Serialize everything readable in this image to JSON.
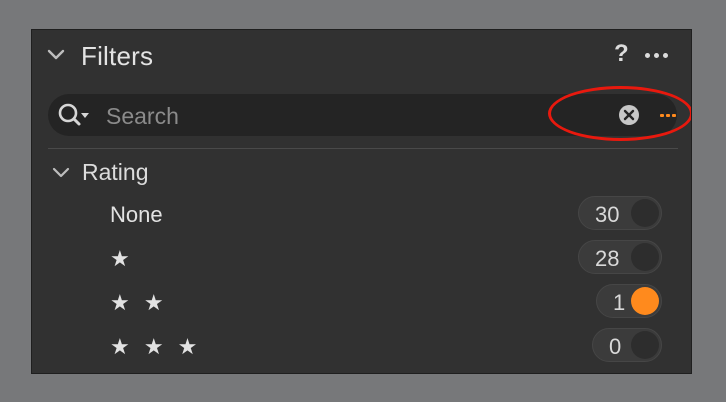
{
  "header": {
    "title": "Filters",
    "help_label": "?"
  },
  "search": {
    "placeholder": "Search",
    "value": ""
  },
  "rating": {
    "label": "Rating",
    "rows": [
      {
        "label": "None",
        "count": "30",
        "active": false
      },
      {
        "label": "★",
        "count": "28",
        "active": false
      },
      {
        "label": "★ ★",
        "count": "1",
        "active": true
      },
      {
        "label": "★ ★ ★",
        "count": "0",
        "active": false
      }
    ]
  },
  "colors": {
    "accent": "#ff8a1d",
    "annotation": "#e8190e",
    "panel": "#313131"
  },
  "icons": [
    "chevron-down-icon",
    "search-icon",
    "clear-icon",
    "more-icon",
    "options-icon"
  ]
}
